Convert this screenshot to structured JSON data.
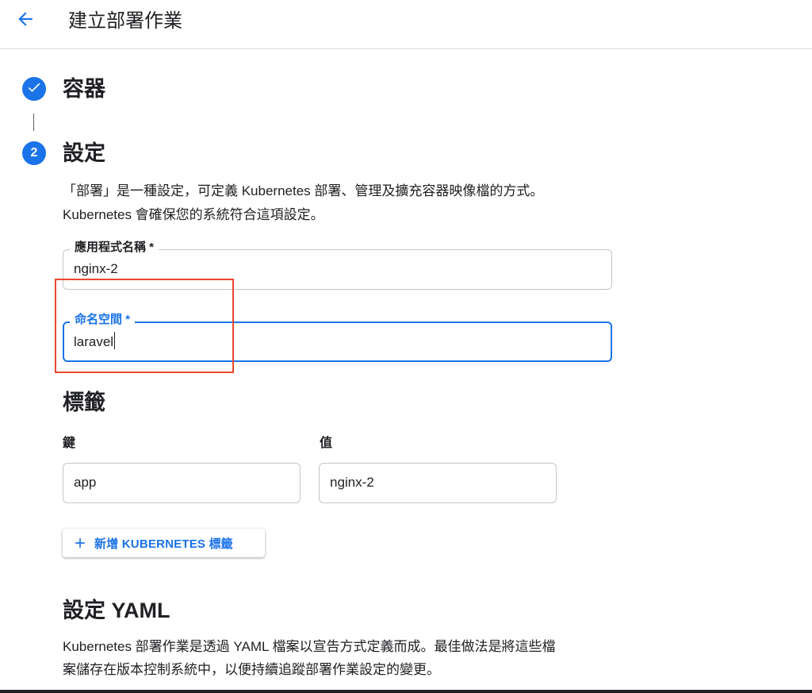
{
  "header": {
    "title": "建立部署作業"
  },
  "stepper": {
    "steps": [
      {
        "number": "",
        "title": "容器",
        "state": "completed"
      },
      {
        "number": "2",
        "title": "設定",
        "state": "active"
      }
    ]
  },
  "config": {
    "description_line1": "「部署」是一種設定，可定義 Kubernetes 部署、管理及擴充容器映像檔的方式。",
    "description_line2": "Kubernetes 會確保您的系統符合這項設定。",
    "app_name": {
      "label": "應用程式名稱 *",
      "value": "nginx-2"
    },
    "namespace": {
      "label": "命名空間 *",
      "value": "laravel"
    }
  },
  "labels": {
    "title": "標籤",
    "key_header": "鍵",
    "value_header": "值",
    "key_value": "app",
    "value_value": "nginx-2",
    "add_button": "新增 KUBERNETES 標籤"
  },
  "yaml": {
    "title": "設定 YAML",
    "description_line1": "Kubernetes 部署作業是透過 YAML 檔案以宣告方式定義而成。最佳做法是將這些檔",
    "description_line2": "案儲存在版本控制系統中，以便持續追蹤部署作業設定的變更。"
  },
  "colors": {
    "accent": "#1a73e8",
    "highlight": "#e8472f",
    "text": "#202124",
    "border": "#c4c7c5"
  },
  "icons": {
    "back": "arrow-back-icon",
    "step_done": "check-icon",
    "add": "plus-icon"
  }
}
